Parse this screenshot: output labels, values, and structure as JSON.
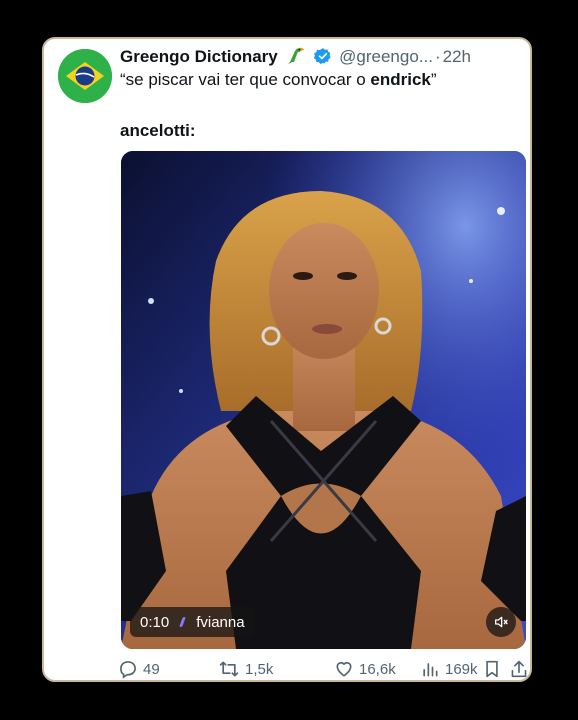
{
  "tweet": {
    "author_name": "Greengo Dictionary",
    "author_emoji": "parrot-emoji",
    "verified_icon": "verified-badge-icon",
    "handle": "@greengo...",
    "separator": "·",
    "time": "22h",
    "text_prefix": "“se piscar vai ter que convocar o ",
    "text_bold": "endrick",
    "text_suffix": "”",
    "second_line": "ancelotti:"
  },
  "video": {
    "timestamp": "0:10",
    "watermark": "fvianna",
    "mute_icon": "speaker-muted-icon"
  },
  "actions": {
    "replies": "49",
    "reposts": "1,5k",
    "likes": "16,6k",
    "views": "169k",
    "bookmark_icon": "bookmark-icon",
    "share_icon": "share-icon"
  },
  "colors": {
    "background": "#000000",
    "card": "#ffffff",
    "verified": "#1d9bf0",
    "muted_text": "#536471",
    "avatar_green": "#2fb14a"
  }
}
